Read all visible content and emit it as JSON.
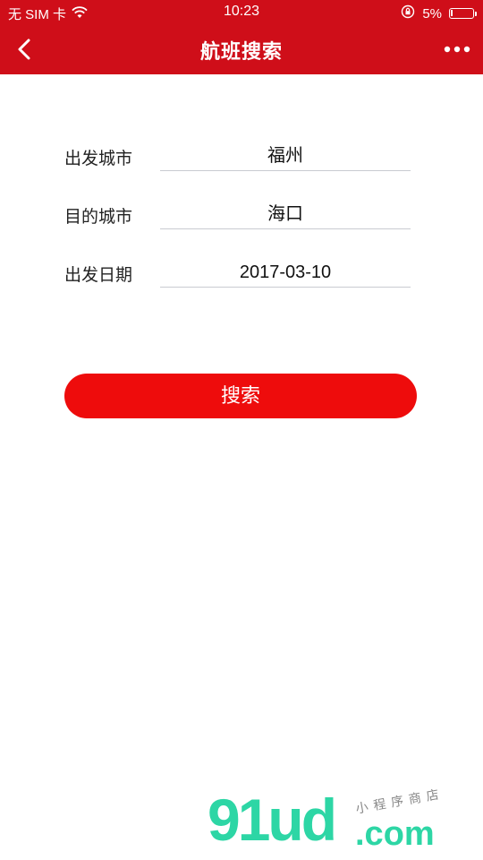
{
  "status_bar": {
    "carrier": "无 SIM 卡",
    "time": "10:23",
    "battery_text": "5%",
    "battery_level": 0.05,
    "icons": [
      "wifi-icon",
      "rotation-lock-icon",
      "battery-icon"
    ]
  },
  "nav": {
    "title": "航班搜索",
    "back_icon": "back-chevron-icon",
    "more_icon": "more-dots-icon"
  },
  "form": {
    "rows": [
      {
        "label": "出发城市",
        "value": "福州"
      },
      {
        "label": "目的城市",
        "value": "海口"
      },
      {
        "label": "出发日期",
        "value": "2017-03-10"
      }
    ]
  },
  "actions": {
    "search_label": "搜索"
  },
  "watermark": {
    "main": "91ud",
    "domain": ".com",
    "tagline": "小程序商店"
  },
  "colors": {
    "header_red": "#cf0e19",
    "button_red": "#ee0c0c",
    "watermark_green": "#2dd6a5"
  }
}
